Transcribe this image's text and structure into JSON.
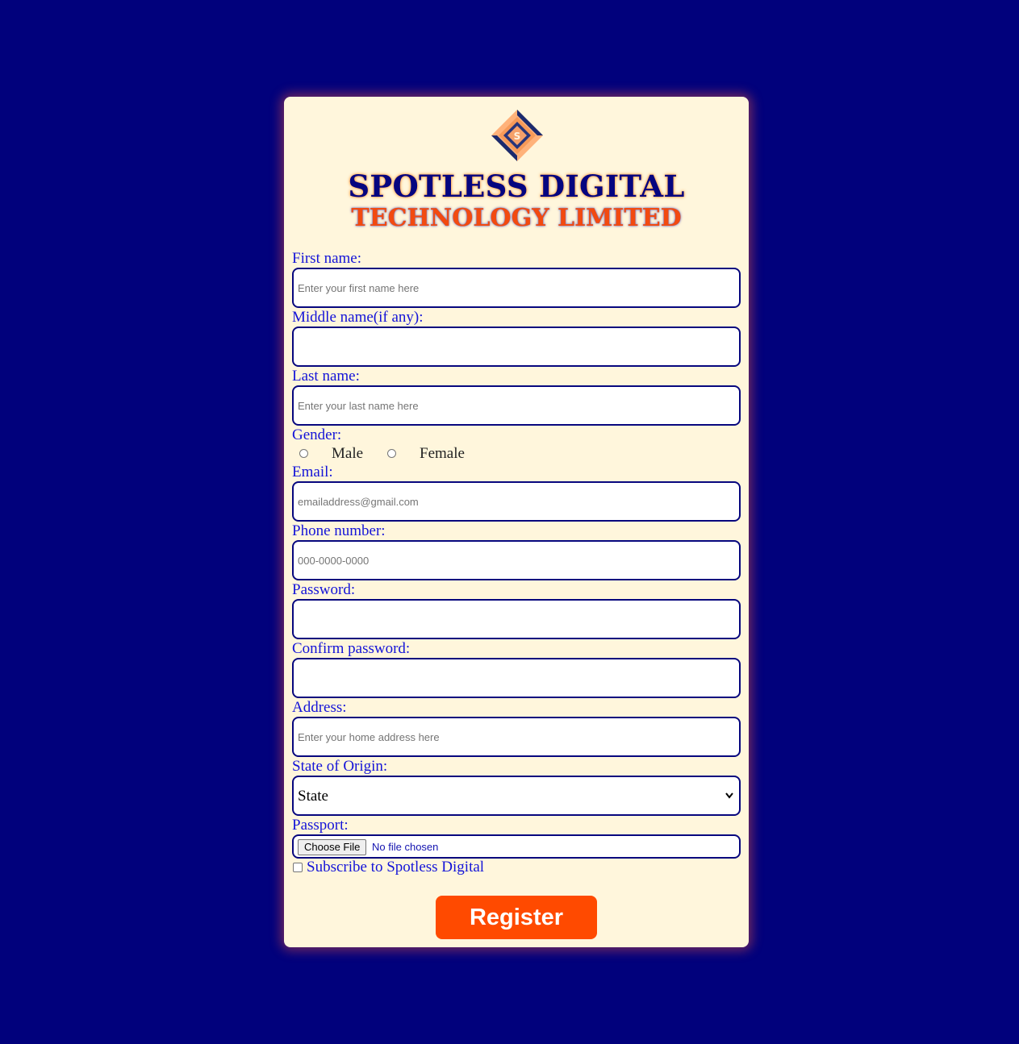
{
  "brand": {
    "name_line1": "SPOTLESS DIGITAL",
    "name_line2": "TECHNOLOGY LIMITED",
    "logo_icon": "spotless-s-diamond-logo",
    "colors": {
      "navy": "#07077e",
      "orange": "#ff4a00",
      "card_bg": "#fff6dc",
      "page_bg": "#01017c"
    }
  },
  "form": {
    "first_name": {
      "label": "First name:",
      "placeholder": "Enter your first name here",
      "value": ""
    },
    "middle_name": {
      "label": "Middle name(if any):",
      "placeholder": "",
      "value": ""
    },
    "last_name": {
      "label": "Last name:",
      "placeholder": "Enter your last name here",
      "value": ""
    },
    "gender": {
      "label": "Gender:",
      "options": [
        "Male",
        "Female"
      ]
    },
    "email": {
      "label": "Email:",
      "placeholder": "emailaddress@gmail.com",
      "value": ""
    },
    "phone": {
      "label": "Phone number:",
      "placeholder": "000-0000-0000",
      "value": ""
    },
    "password": {
      "label": "Password:",
      "placeholder": "",
      "value": ""
    },
    "confirm_password": {
      "label": "Confirm password:",
      "placeholder": "",
      "value": ""
    },
    "address": {
      "label": "Address:",
      "placeholder": "Enter your home address here",
      "value": ""
    },
    "state": {
      "label": "State of Origin:",
      "selected": "State"
    },
    "passport": {
      "label": "Passport:",
      "button_label": "Choose File",
      "status": "No file chosen"
    },
    "subscribe": {
      "label": "Subscribe to Spotless Digital",
      "checked": false
    },
    "submit_label": "Register"
  }
}
